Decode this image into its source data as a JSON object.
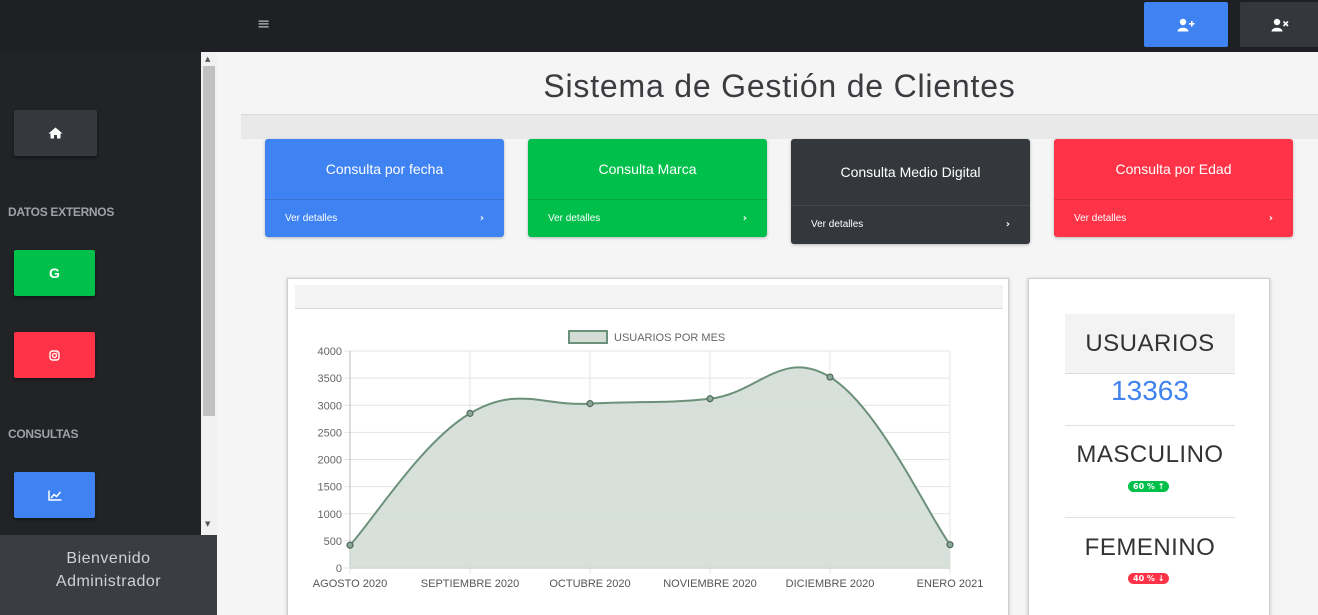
{
  "topbar": {
    "menu_icon": "hamburger-icon",
    "buttons": [
      {
        "icon": "user-plus-icon",
        "color": "#3f82f2"
      },
      {
        "icon": "user-times-icon",
        "color": "#34373c"
      }
    ]
  },
  "sidebar": {
    "home_icon": "home-icon",
    "section_external": "DATOS EXTERNOS",
    "google_label": "G",
    "instagram_icon": "instagram-icon",
    "section_queries": "CONSULTAS",
    "chart_icon": "chart-icon",
    "welcome_line1": "Bienvenido",
    "welcome_line2": "Administrador"
  },
  "header": {
    "title": "Sistema de Gestión de Clientes"
  },
  "cards": [
    {
      "title": "Consulta por fecha",
      "link": "Ver detalles",
      "color": "#3f82f2"
    },
    {
      "title": "Consulta Marca",
      "link": "Ver detalles",
      "color": "#00c04b"
    },
    {
      "title": "Consulta Medio Digital",
      "link": "Ver detalles",
      "color": "#34373c"
    },
    {
      "title": "Consulta por Edad",
      "link": "Ver detalles",
      "color": "#ff3347"
    }
  ],
  "chart_data": {
    "type": "line",
    "legend": "USUARIOS POR MES",
    "legend_position": "top",
    "categories": [
      "AGOSTO 2020",
      "SEPTIEMBRE 2020",
      "OCTUBRE 2020",
      "NOVIEMBRE 2020",
      "DICIEMBRE 2020",
      "ENERO 2021"
    ],
    "values": [
      420,
      2850,
      3030,
      3120,
      3520,
      430
    ],
    "ylim": [
      0,
      4000
    ],
    "yticks": [
      0,
      500,
      1000,
      1500,
      2000,
      2500,
      3000,
      3500,
      4000
    ],
    "grid": true,
    "filled": true,
    "line_color": "#6b917a",
    "fill_color": "#d3ddd6"
  },
  "stats": {
    "users_label": "USUARIOS",
    "users_count": "13363",
    "male_label": "MASCULINO",
    "male_pct": "60 %",
    "female_label": "FEMENINO",
    "female_pct": "40 %"
  }
}
